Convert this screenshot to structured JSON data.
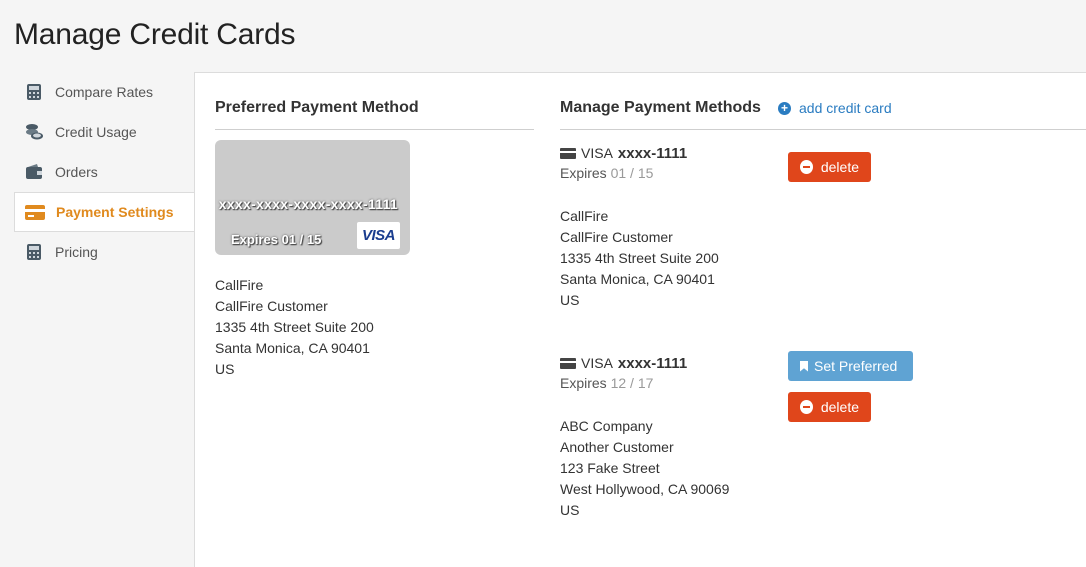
{
  "page": {
    "title": "Manage Credit Cards"
  },
  "sidebar": {
    "items": [
      {
        "label": "Compare Rates",
        "icon": "calculator-icon",
        "active": false
      },
      {
        "label": "Credit Usage",
        "icon": "coins-icon",
        "active": false
      },
      {
        "label": "Orders",
        "icon": "wallet-icon",
        "active": false
      },
      {
        "label": "Payment Settings",
        "icon": "credit-card-icon",
        "active": true
      },
      {
        "label": "Pricing",
        "icon": "calculator-icon",
        "active": false
      }
    ]
  },
  "preferred": {
    "title": "Preferred Payment Method",
    "card": {
      "number": "xxxx-xxxx-xxxx-xxxx-1111",
      "expires": "Expires 01 / 15",
      "brand": "VISA"
    },
    "address": [
      "CallFire",
      "CallFire Customer",
      "1335 4th Street Suite 200",
      "Santa Monica, CA 90401",
      "US"
    ]
  },
  "manage": {
    "title": "Manage Payment Methods",
    "add_label": "add credit card",
    "methods": [
      {
        "brand": "VISA",
        "number": "xxxx-1111",
        "expires_label": "Expires",
        "expires_value": "01 / 15",
        "address": [
          "CallFire",
          "CallFire Customer",
          "1335 4th Street Suite 200",
          "Santa Monica, CA 90401",
          "US"
        ],
        "delete_label": "delete"
      },
      {
        "brand": "VISA",
        "number": "xxxx-1111",
        "expires_label": "Expires",
        "expires_value": "12 / 17",
        "address": [
          "ABC Company",
          "Another Customer",
          "123 Fake Street",
          "West Hollywood, CA 90069",
          "US"
        ],
        "set_preferred_label": "Set Preferred",
        "delete_label": "delete"
      }
    ]
  },
  "colors": {
    "accent": "#e08a1e",
    "link": "#2a7cc1",
    "danger": "#e0461b",
    "info": "#5fa3d3"
  }
}
